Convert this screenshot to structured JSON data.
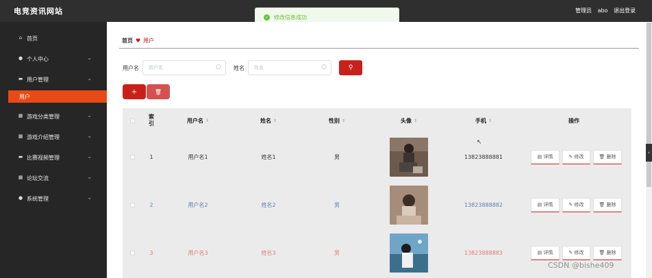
{
  "topbar": {
    "title": "电竞资讯网站",
    "role": "管理员",
    "username": "abo",
    "logout": "退出登录"
  },
  "toast": {
    "message": "修改信息成功"
  },
  "sidebar": {
    "items": [
      {
        "label": "首页",
        "icon": "home-icon",
        "chevron": false
      },
      {
        "label": "个人中心",
        "icon": "user-icon",
        "chevron": true
      },
      {
        "label": "用户管理",
        "icon": "monitor-icon",
        "chevron": true
      },
      {
        "label": "游戏分类管理",
        "icon": "grid-icon",
        "chevron": true
      },
      {
        "label": "游戏介绍管理",
        "icon": "grid-icon",
        "chevron": true
      },
      {
        "label": "比赛视频管理",
        "icon": "monitor-icon",
        "chevron": true
      },
      {
        "label": "论坛交流",
        "icon": "grid-icon",
        "chevron": true
      },
      {
        "label": "系统管理",
        "icon": "user-icon",
        "chevron": true
      }
    ],
    "active_sub": "用户"
  },
  "breadcrumb": {
    "home": "首页",
    "current": "用户"
  },
  "search": {
    "username_label": "用户名",
    "username_placeholder": "用户名",
    "name_label": "姓名",
    "name_placeholder": "姓名"
  },
  "table": {
    "headers": [
      "索引",
      "用户名",
      "姓名",
      "性别",
      "头像",
      "手机",
      "操作"
    ],
    "rows": [
      {
        "index": "1",
        "username": "用户名1",
        "name": "姓名1",
        "gender": "男",
        "phone": "13823888881"
      },
      {
        "index": "2",
        "username": "用户名2",
        "name": "姓名2",
        "gender": "男",
        "phone": "13823888882"
      },
      {
        "index": "3",
        "username": "用户名3",
        "name": "姓名3",
        "gender": "男",
        "phone": "13823888883"
      }
    ],
    "ops": [
      "详情",
      "修改",
      "删除"
    ]
  },
  "watermark": "CSDN @bishe409",
  "colors": {
    "accent": "#c8211c",
    "sidebar_active": "#e84a16",
    "row2_text": "#5a7fb0",
    "row3_text": "#e07a7a"
  }
}
